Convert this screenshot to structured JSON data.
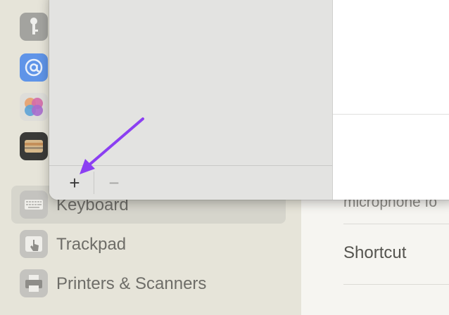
{
  "sidebar": {
    "items": [
      {
        "icon": "key-icon",
        "label": "",
        "color": "#9a9a96"
      },
      {
        "icon": "at-sign-icon",
        "label": "",
        "color": "#4f8ef5"
      },
      {
        "icon": "game-center-icon",
        "label": "",
        "color": "#e0dfe0"
      },
      {
        "icon": "wallet-icon",
        "label": "",
        "color": "#2b2b2b"
      },
      {
        "icon": "keyboard-icon",
        "label": "Keyboard",
        "color": "#bcbcb8",
        "selected": true
      },
      {
        "icon": "trackpad-icon",
        "label": "Trackpad",
        "color": "#bcbcb8"
      },
      {
        "icon": "printer-icon",
        "label": "Printers & Scanners",
        "color": "#bcbcb8"
      }
    ]
  },
  "right_pane": {
    "partial_text": "microphone fo",
    "row_label": "Shortcut"
  },
  "sheet": {
    "add_label": "+",
    "remove_label": "−"
  },
  "annotation": {
    "arrow_color": "#8b3ff2"
  }
}
